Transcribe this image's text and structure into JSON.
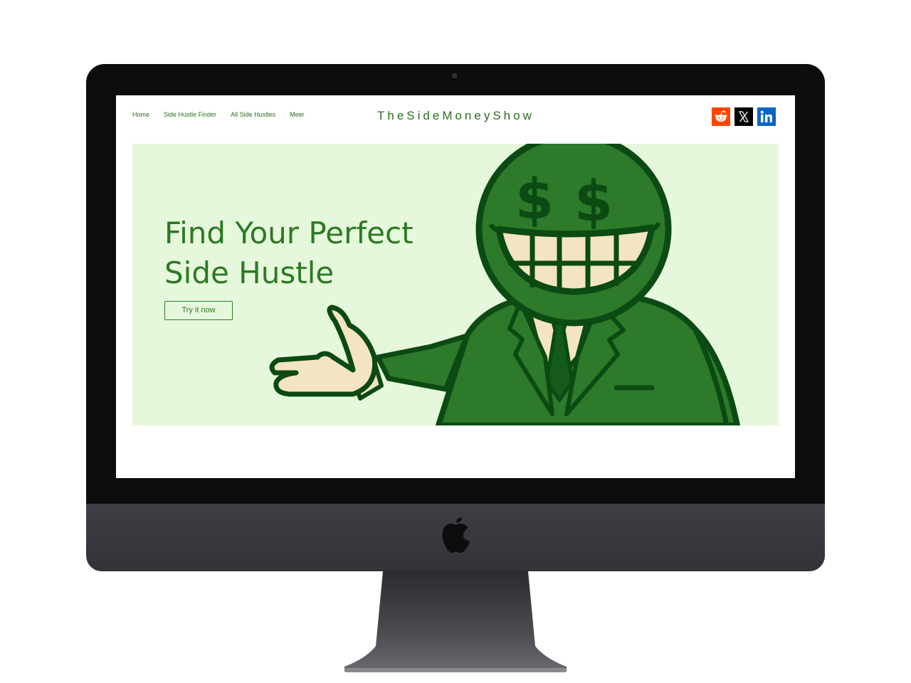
{
  "nav": {
    "items": [
      {
        "label": "Home"
      },
      {
        "label": "Side Hustle Finder"
      },
      {
        "label": "All Side Hustles"
      },
      {
        "label": "Meer"
      }
    ]
  },
  "site": {
    "title": "TheSideMoneyShow"
  },
  "social": {
    "icons": [
      "reddit-icon",
      "x-icon",
      "linkedin-icon"
    ],
    "colors": {
      "reddit": "#ff4500",
      "x": "#000000",
      "linkedin": "#0a66c2"
    }
  },
  "hero": {
    "title_line1": "Find Your Perfect",
    "title_line2": "Side Hustle",
    "cta_label": "Try it now",
    "background": "#e6f8dc"
  },
  "theme": {
    "accent": "#2b7a22"
  }
}
